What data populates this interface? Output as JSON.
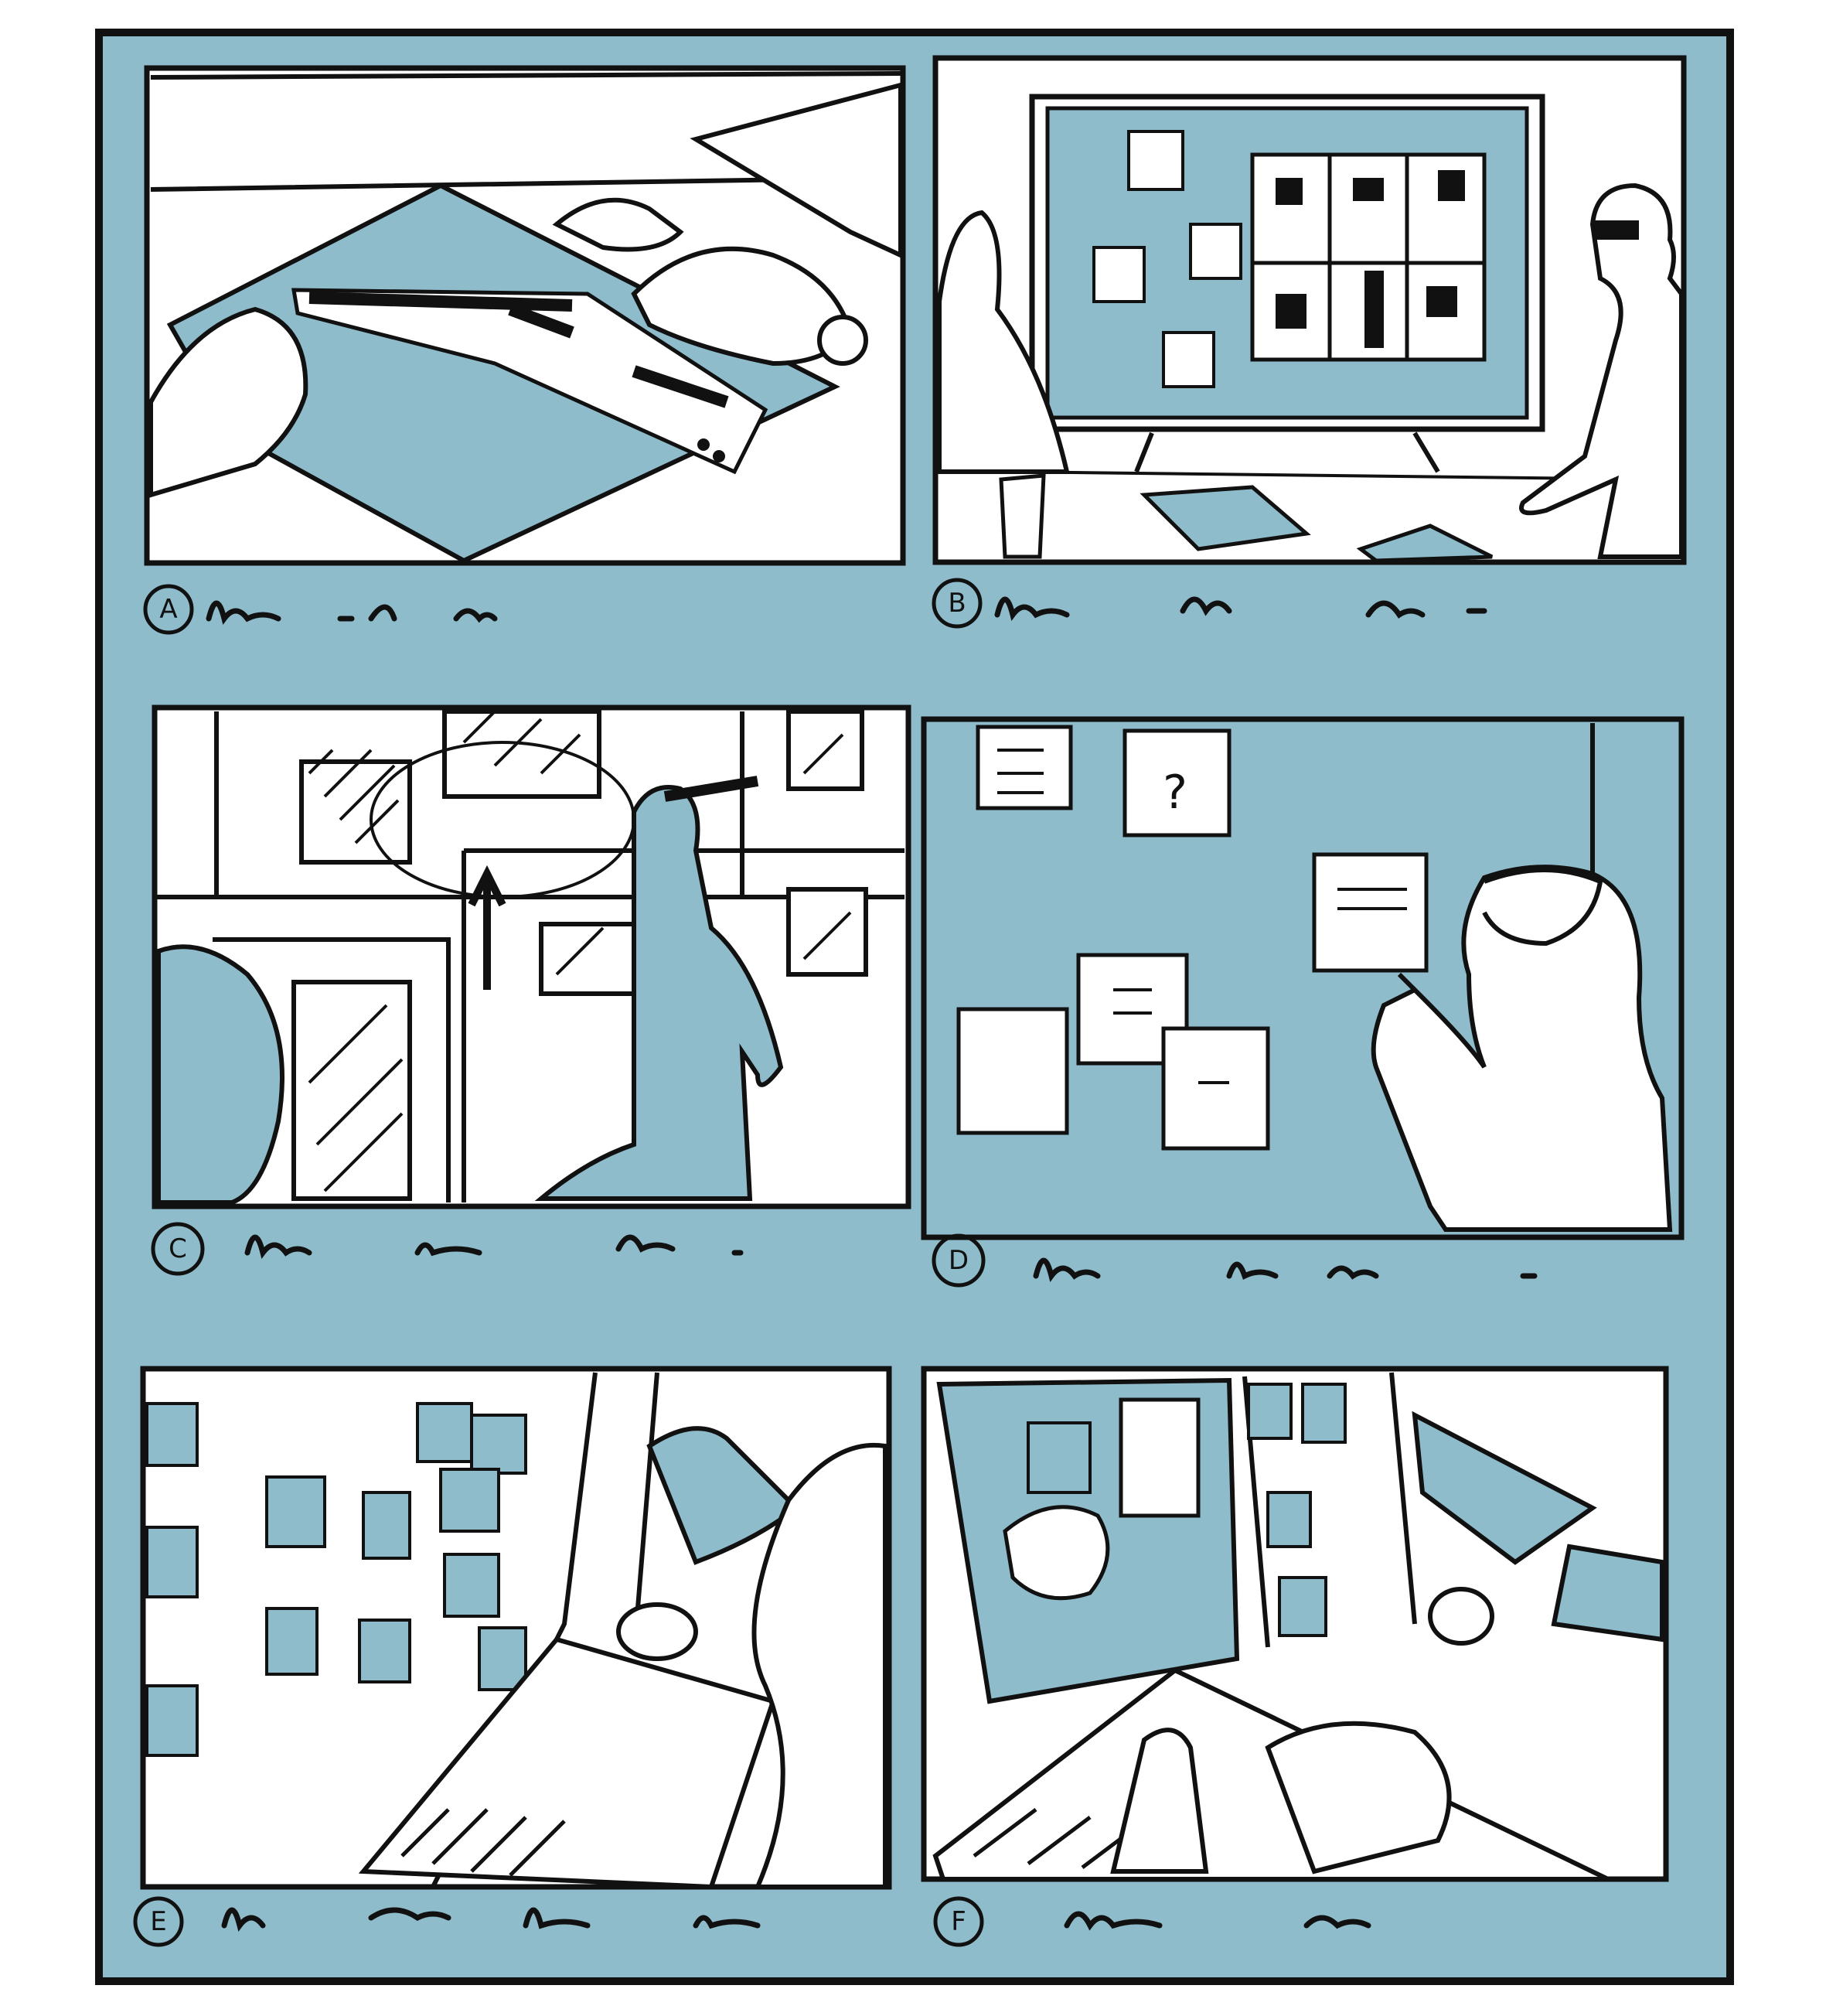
{
  "colors": {
    "blue": "#8fbccb",
    "ink": "#111111",
    "paper": "#ffffff"
  },
  "panels": [
    {
      "label": "A",
      "scene": "hands-with-paper-strip"
    },
    {
      "label": "B",
      "scene": "monitor-with-notes-two-people"
    },
    {
      "label": "C",
      "scene": "drawing-arrow-on-board"
    },
    {
      "label": "D",
      "scene": "person-pointing-at-sticky-notes"
    },
    {
      "label": "E",
      "scene": "laptop-with-sticky-note-wall"
    },
    {
      "label": "F",
      "scene": "typing-on-laptop-with-board"
    }
  ]
}
